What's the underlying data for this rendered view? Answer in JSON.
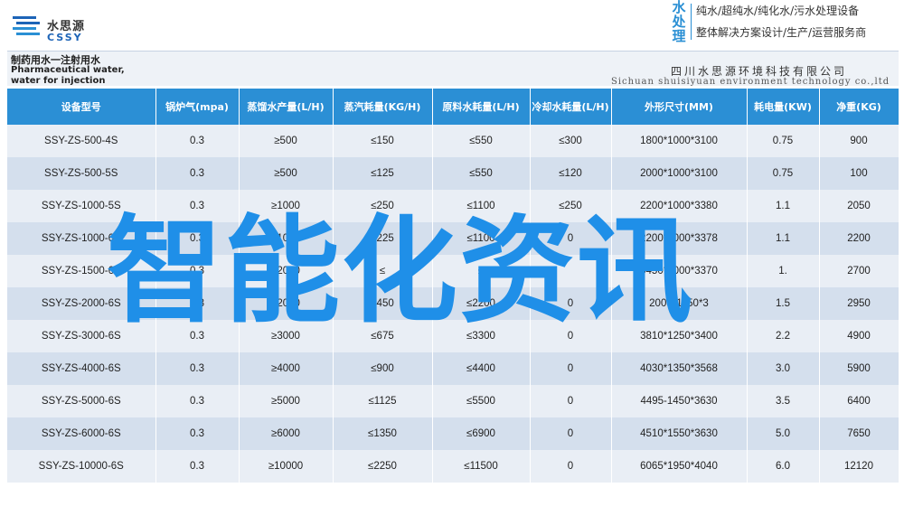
{
  "header": {
    "logo_cn": "水思源",
    "logo_en": "CSSY",
    "brand_vertical": [
      "水",
      "处",
      "理"
    ],
    "tagline1": "纯水/超纯水/纯化水/污水处理设备",
    "tagline2": "整体解决方案设计/生产/运营服务商"
  },
  "subheader": {
    "title_cn": "制药用水一注射用水",
    "title_en": "Pharmaceutical water, water for injection",
    "company_cn": "四川水思源环境科技有限公司",
    "company_en": "Sichuan shuisiyuan environment technology co.,ltd"
  },
  "table": {
    "headers": [
      "设备型号",
      "锅炉气(mpa)",
      "蒸馏水产量(L/H)",
      "蒸汽耗量(KG/H)",
      "原料水耗量(L/H)",
      "冷却水耗量(L/H)",
      "外形尺寸(MM)",
      "耗电量(KW)",
      "净重(KG)"
    ],
    "rows": [
      [
        "SSY-ZS-500-4S",
        "0.3",
        "≥500",
        "≤150",
        "≤550",
        "≤300",
        "1800*1000*3100",
        "0.75",
        "900"
      ],
      [
        "SSY-ZS-500-5S",
        "0.3",
        "≥500",
        "≤125",
        "≤550",
        "≤120",
        "2000*1000*3100",
        "0.75",
        "100"
      ],
      [
        "SSY-ZS-1000-5S",
        "0.3",
        "≥1000",
        "≤250",
        "≤1100",
        "≤250",
        "2200*1000*3380",
        "1.1",
        "2050"
      ],
      [
        "SSY-ZS-1000-6S",
        "0.3",
        "≥1000",
        "≤225",
        "≤1100",
        "0",
        "2200*1000*3378",
        "1.1",
        "2200"
      ],
      [
        "SSY-ZS-1500-6S",
        "0.3",
        "≥2000",
        "≤",
        "≤",
        "",
        "3450*1000*3370",
        "1.",
        "2700"
      ],
      [
        "SSY-ZS-2000-6S",
        "0.3",
        "≥2000",
        "≤450",
        "≤2200",
        "0",
        "2000*1150*3",
        "1.5",
        "2950"
      ],
      [
        "SSY-ZS-3000-6S",
        "0.3",
        "≥3000",
        "≤675",
        "≤3300",
        "0",
        "3810*1250*3400",
        "2.2",
        "4900"
      ],
      [
        "SSY-ZS-4000-6S",
        "0.3",
        "≥4000",
        "≤900",
        "≤4400",
        "0",
        "4030*1350*3568",
        "3.0",
        "5900"
      ],
      [
        "SSY-ZS-5000-6S",
        "0.3",
        "≥5000",
        "≤1125",
        "≤5500",
        "0",
        "4495-1450*3630",
        "3.5",
        "6400"
      ],
      [
        "SSY-ZS-6000-6S",
        "0.3",
        "≥6000",
        "≤1350",
        "≤6900",
        "0",
        "4510*1550*3630",
        "5.0",
        "7650"
      ],
      [
        "SSY-ZS-10000-6S",
        "0.3",
        "≥10000",
        "≤2250",
        "≤11500",
        "0",
        "6065*1950*4040",
        "6.0",
        "12120"
      ]
    ]
  },
  "watermark": "智能化资讯",
  "colors": {
    "header_blue": "#2b8fd5",
    "row_light": "#e9eef5",
    "row_dark": "#d4dfed",
    "watermark": "#1f8fe8"
  }
}
